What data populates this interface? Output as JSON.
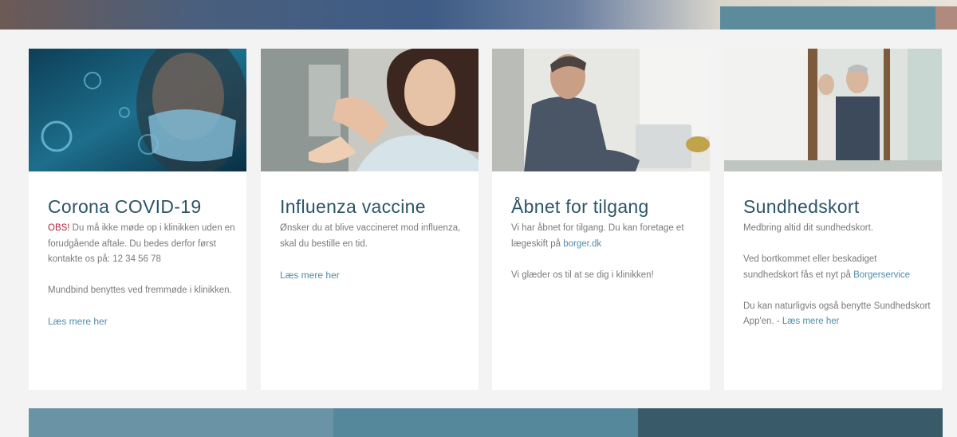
{
  "cards": [
    {
      "title": "Corona COVID-19",
      "obs": "OBS!",
      "text1": " Du må ikke møde op i klinikken uden en forudgående aftale. Du bedes derfor først kontakte os på: 12 34 56 78",
      "text2": "Mundbind benyttes ved fremmøde i klinikken.",
      "link": "Læs mere her"
    },
    {
      "title": "Influenza vaccine",
      "text1": "Ønsker du at blive vaccineret mod influenza, skal du bestille en tid.",
      "link": "Læs mere her"
    },
    {
      "title": "Åbnet for tilgang",
      "text1_pre": "Vi har åbnet for tilgang. Du kan foretage et lægeskift på ",
      "text1_link": "borger.dk",
      "text2": "Vi glæder os til at se dig i klinikken!"
    },
    {
      "title": "Sundhedskort",
      "text1": "Medbring altid dit sundhedskort.",
      "text2_pre": "Ved bortkommet eller beskadiget sundhedskort fås et nyt på ",
      "text2_link": "Borgerservice",
      "text3_pre": "Du kan naturligvis også benytte Sundhedskort App'en. - ",
      "text3_link": "Læs mere her"
    }
  ],
  "colors": {
    "title": "#2b5566",
    "link": "#4f8cab",
    "obs": "#b3243a",
    "footer": [
      "#6a93a6",
      "#56889c",
      "#395a69"
    ]
  }
}
